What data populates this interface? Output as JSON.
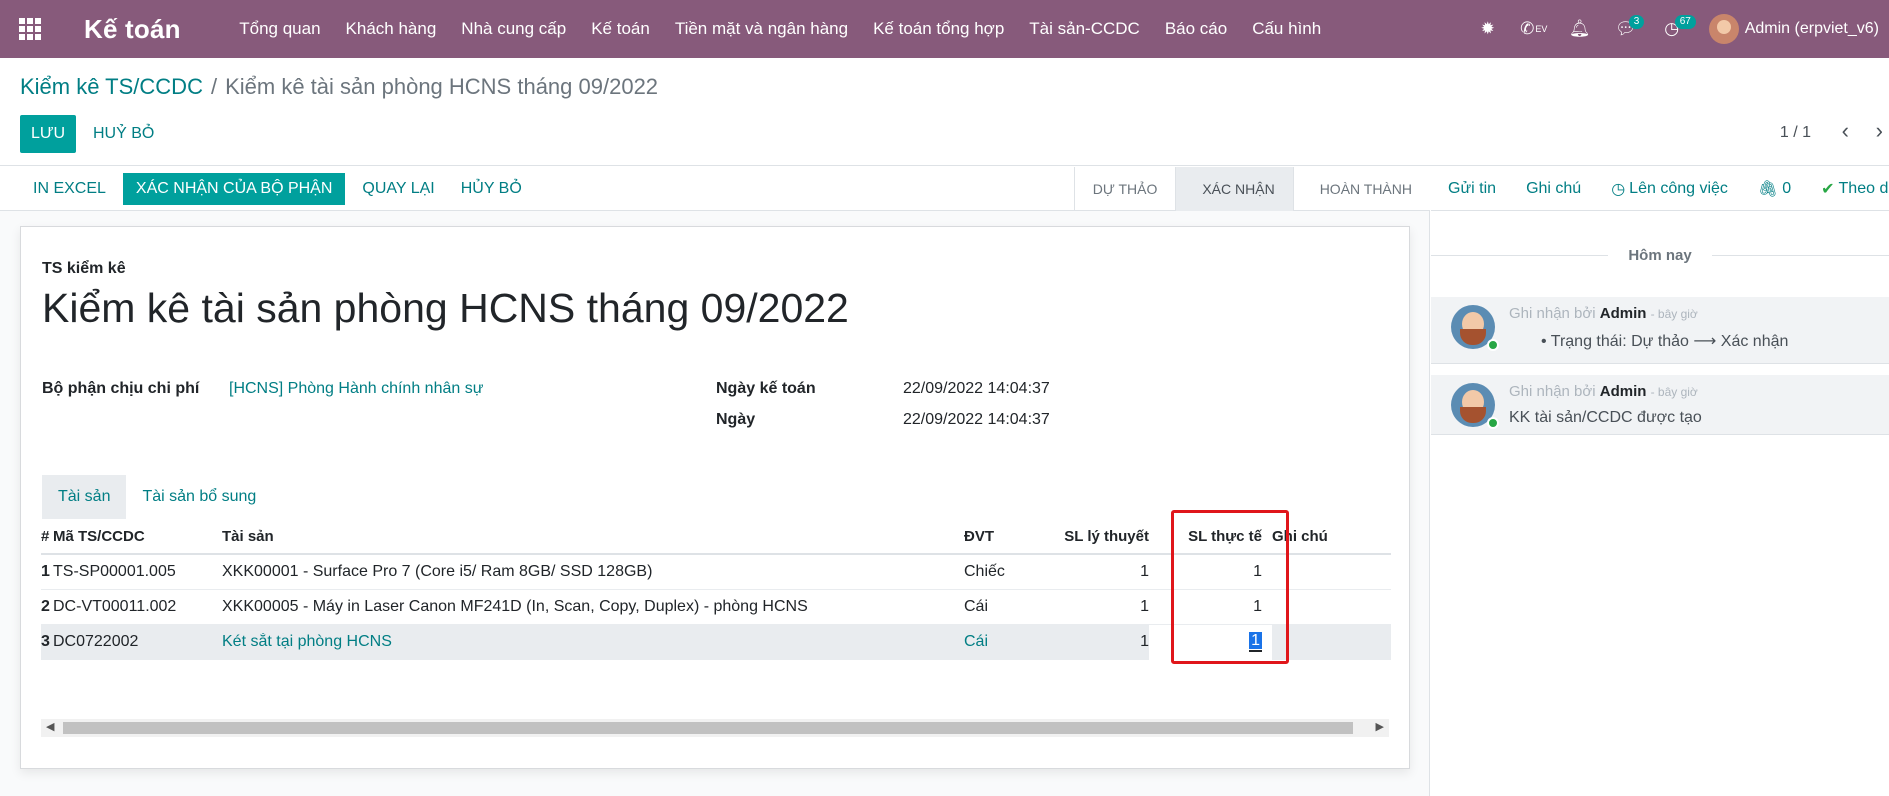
{
  "navbar": {
    "brand": "Kế toán",
    "menu": [
      "Tổng quan",
      "Khách hàng",
      "Nhà cung cấp",
      "Kế toán",
      "Tiền mặt và ngân hàng",
      "Kế toán tổng hợp",
      "Tài sản-CCDC",
      "Báo cáo",
      "Cấu hình"
    ],
    "systray": {
      "bug_icon": "bug-icon",
      "voip_label": "EV",
      "bell_icon": "bell-icon",
      "messages_count": "3",
      "activities_count": "67",
      "user_name": "Admin (erpviet_v6)"
    }
  },
  "control_panel": {
    "breadcrumb_parent": "Kiểm kê TS/CCDC",
    "breadcrumb_current": "Kiểm kê tài sản phòng HCNS tháng 09/2022",
    "save_label": "LƯU",
    "discard_label": "HUỶ BỎ",
    "pager_value": "1 / 1"
  },
  "statusbar": {
    "buttons": [
      "IN EXCEL",
      "XÁC NHẬN CỦA BỘ PHẬN",
      "QUAY LẠI",
      "HỦY BỎ"
    ],
    "stages": [
      "DỰ THẢO",
      "XÁC NHẬN",
      "HOÀN THÀNH"
    ],
    "active_stage": "XÁC NHẬN"
  },
  "form": {
    "record_type": "TS kiểm kê",
    "title": "Kiểm kê tài sản phòng HCNS tháng 09/2022",
    "department_label": "Bộ phận chịu chi phí",
    "department_value": "[HCNS] Phòng Hành chính nhân sự",
    "accounting_date_label": "Ngày kế toán",
    "accounting_date_value": "22/09/2022 14:04:37",
    "date_label": "Ngày",
    "date_value": "22/09/2022 14:04:37"
  },
  "tabs": [
    "Tài sản",
    "Tài sản bổ sung"
  ],
  "table": {
    "headers": {
      "num": "#",
      "code": "Mã TS/CCDC",
      "asset": "Tài sản",
      "uom": "ĐVT",
      "theory_qty": "SL lý thuyết",
      "actual_qty": "SL thực tế",
      "note": "Ghi chú"
    },
    "rows": [
      {
        "num": "1",
        "code": "TS-SP00001.005",
        "asset": "XKK00001 - Surface Pro 7 (Core i5/ Ram 8GB/ SSD 128GB)",
        "uom": "Chiếc",
        "theory_qty": "1",
        "actual_qty": "1",
        "note": ""
      },
      {
        "num": "2",
        "code": "DC-VT00011.002",
        "asset": "XKK00005 - Máy in Laser Canon MF241D (In, Scan, Copy, Duplex) - phòng HCNS",
        "uom": "Cái",
        "theory_qty": "1",
        "actual_qty": "1",
        "note": ""
      },
      {
        "num": "3",
        "code": "DC0722002",
        "asset": "Két sắt tại phòng HCNS",
        "uom": "Cái",
        "theory_qty": "1",
        "actual_qty": "1",
        "note": ""
      }
    ]
  },
  "chatter": {
    "send_message": "Gửi tin",
    "log_note": "Ghi chú",
    "schedule_activity": "Lên công việc",
    "attachments_count": "0",
    "follow": "Theo dõi",
    "day_label": "Hôm nay",
    "messages": [
      {
        "prefix": "Ghi nhận bởi",
        "author": "Admin",
        "time": "- bây giờ",
        "body": "Trạng thái: Dự thảo ⟶ Xác nhận"
      },
      {
        "prefix": "Ghi nhận bởi",
        "author": "Admin",
        "time": "- bây giờ",
        "body": "KK tài sản/CCDC được tạo"
      }
    ]
  },
  "colors": {
    "navbar": "#875a7b",
    "primary": "#00a09d",
    "link": "#017e84",
    "highlight_box": "#e0161b"
  }
}
